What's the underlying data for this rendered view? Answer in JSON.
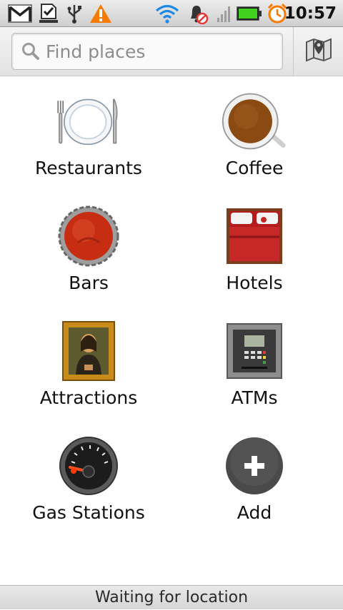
{
  "status_bar": {
    "time": "10:57",
    "icons": [
      "gmail-icon",
      "download-complete-icon",
      "usb-icon",
      "warning-icon",
      "wifi-icon",
      "alarm-muted-icon",
      "signal-icon",
      "battery-icon",
      "alarm-clock-icon"
    ]
  },
  "search": {
    "placeholder": "Find places",
    "map_icon": "map-icon"
  },
  "places": [
    {
      "label": "Restaurants",
      "icon": "restaurant-plate-icon"
    },
    {
      "label": "Coffee",
      "icon": "coffee-cup-icon"
    },
    {
      "label": "Bars",
      "icon": "bottle-cap-icon"
    },
    {
      "label": "Hotels",
      "icon": "hotel-bed-icon"
    },
    {
      "label": "Attractions",
      "icon": "mona-lisa-painting-icon"
    },
    {
      "label": "ATMs",
      "icon": "atm-icon"
    },
    {
      "label": "Gas Stations",
      "icon": "fuel-gauge-icon"
    },
    {
      "label": "Add",
      "icon": "add-plus-icon"
    }
  ],
  "footer": {
    "status_text": "Waiting for location"
  }
}
